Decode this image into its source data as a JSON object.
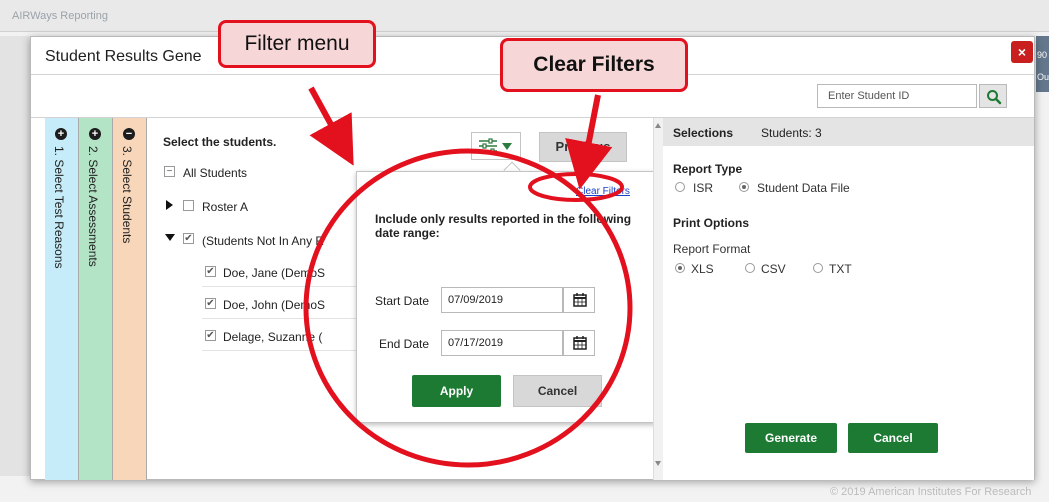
{
  "background": {
    "brand": "AIRWays Reporting",
    "right_text_1": "90",
    "right_text_2": "Ou",
    "footer": "© 2019 American Institutes For Research"
  },
  "modal": {
    "title": "Student Results Gene",
    "close_label": "×",
    "student_id_placeholder": "Enter Student ID"
  },
  "steps": [
    {
      "icon": "plus-circle-icon",
      "label": "1. Select Test Reasons"
    },
    {
      "icon": "plus-circle-icon",
      "label": "2. Select Assessments"
    },
    {
      "icon": "minus-circle-icon",
      "label": "3. Select Students"
    }
  ],
  "students": {
    "title": "Select the students.",
    "previous_label": "Previous",
    "all_label": "All Students",
    "roster_a": "Roster A",
    "not_in_roster": "(Students Not In Any R",
    "rows": [
      "Doe, Jane (DemoS",
      "Doe, John (DemoS",
      "Delage, Suzanne ("
    ]
  },
  "selections": {
    "title": "Selections",
    "count": "Students: 3",
    "report_type": {
      "title": "Report Type",
      "options": [
        "ISR",
        "Student Data File"
      ],
      "selected": "Student Data File"
    },
    "print_options": "Print Options",
    "report_format": {
      "title": "Report Format",
      "options": [
        "XLS",
        "CSV",
        "TXT"
      ],
      "selected": "XLS"
    },
    "generate_label": "Generate",
    "cancel_label": "Cancel"
  },
  "filter_popover": {
    "clear_filters": "Clear Filters",
    "description": "Include only results reported in the following date range:",
    "start_label": "Start Date",
    "start_value": "07/09/2019",
    "end_label": "End Date",
    "end_value": "07/17/2019",
    "apply_label": "Apply",
    "cancel_label": "Cancel"
  },
  "annotations": {
    "filter_menu": "Filter menu",
    "clear_filters": "Clear Filters"
  },
  "colors": {
    "accent_green": "#1d7a33",
    "annotation_red": "#e3101e",
    "close_red": "#c91f1f"
  }
}
